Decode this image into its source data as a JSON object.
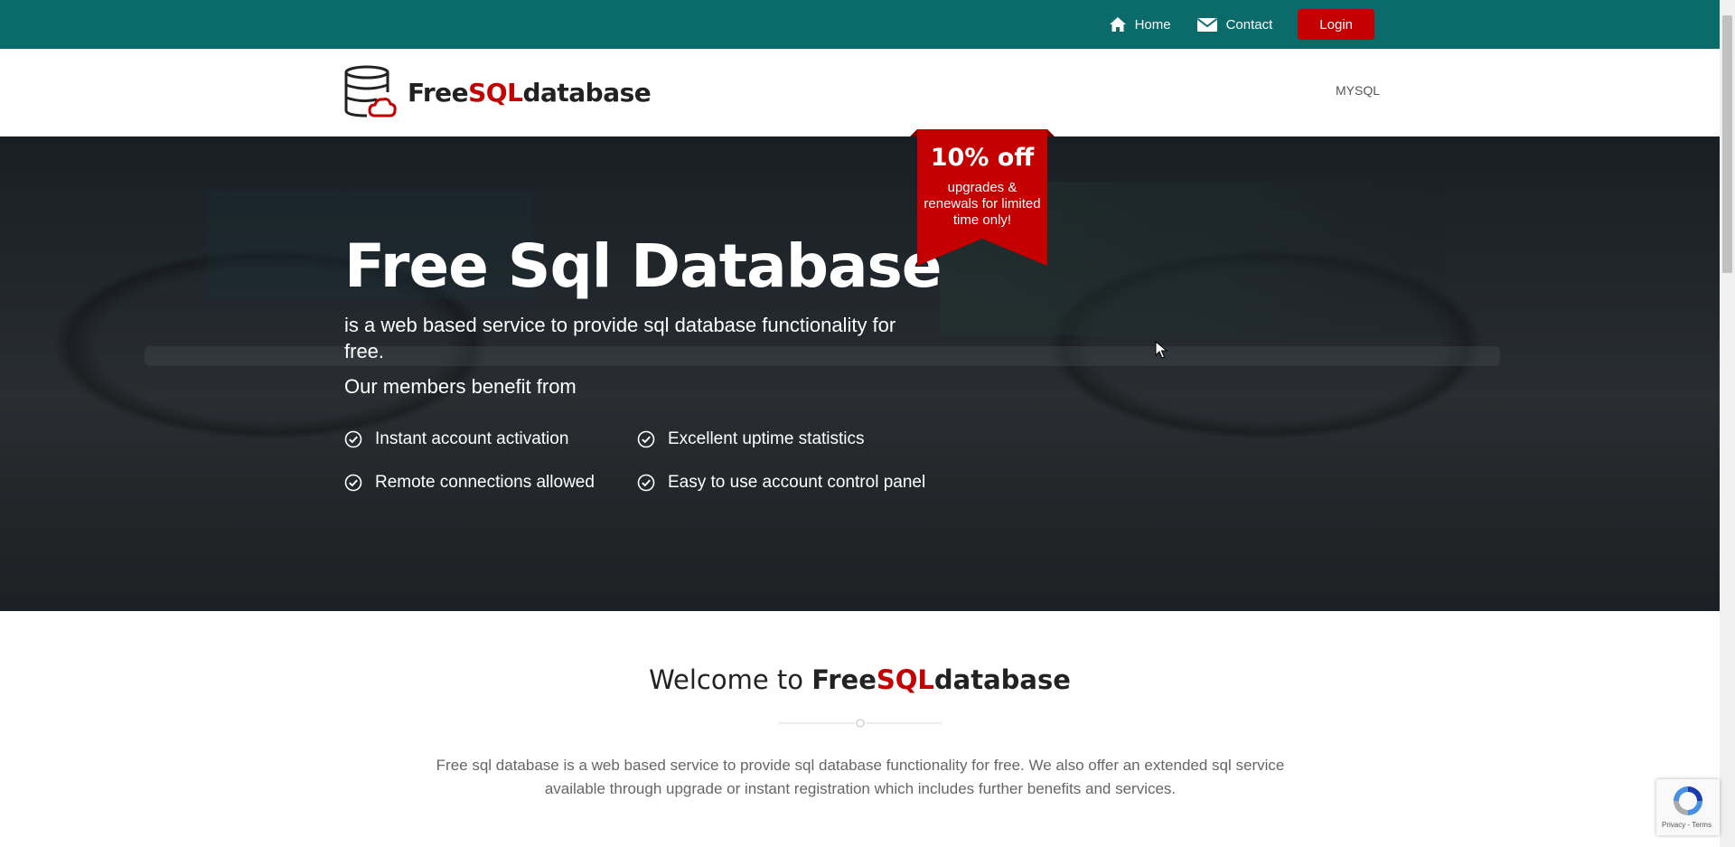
{
  "topnav": {
    "home_label": "Home",
    "contact_label": "Contact",
    "login_label": "Login"
  },
  "header": {
    "logo": {
      "part1": "Free",
      "part2": "SQL",
      "part3": "database"
    },
    "nav_mysql": "MYSQL"
  },
  "hero": {
    "title": "Free Sql Database",
    "lead": "is a web based service to provide sql database functionality for free.",
    "members": "Our members benefit from",
    "features": [
      "Instant account activation",
      "Excellent uptime statistics",
      "Remote connections allowed",
      "Easy to use account control panel"
    ]
  },
  "promo": {
    "title": "10% off",
    "subtitle": "upgrades & renewals for limited time only!"
  },
  "welcome": {
    "prefix": "Welcome to ",
    "brand1": "Free",
    "brand2": "SQL",
    "brand3": "database",
    "description": "Free sql database is a web based service to provide sql database functionality for free. We also offer an extended sql service available through upgrade or instant registration which includes further benefits and services."
  },
  "recaptcha": {
    "text": "Privacy - Terms"
  },
  "colors": {
    "topbar": "#0b6b6b",
    "accent_red": "#c40000",
    "text_dark": "#222222"
  },
  "icons": [
    "home-icon",
    "envelope-icon",
    "database-cloud-icon",
    "check-circle-icon",
    "recaptcha-icon",
    "mouse-cursor-icon"
  ]
}
